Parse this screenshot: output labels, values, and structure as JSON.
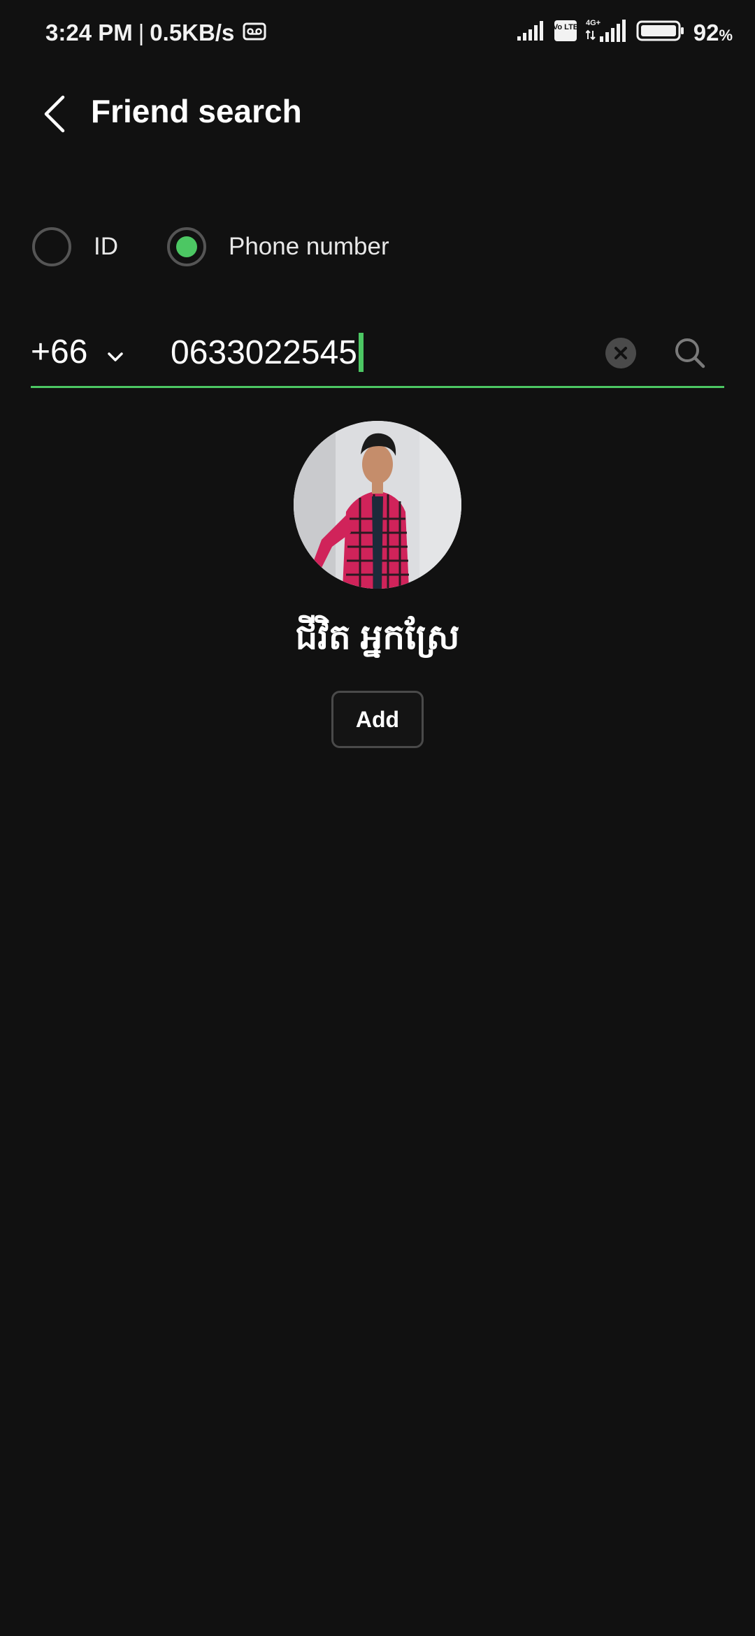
{
  "status_bar": {
    "time": "3:24 PM",
    "separator": "|",
    "speed": "0.5KB/s",
    "battery_value": "92",
    "battery_unit": "%",
    "network_label": "4G+",
    "volte_label": "Vo LTE",
    "icons": [
      "voicemail-icon",
      "signal-icon",
      "volte-icon",
      "signal-4g-icon",
      "battery-icon"
    ]
  },
  "header": {
    "back_icon": "back-arrow-icon",
    "title": "Friend search"
  },
  "search_type": {
    "options": [
      {
        "label": "ID",
        "selected": false
      },
      {
        "label": "Phone number",
        "selected": true
      }
    ]
  },
  "phone_search": {
    "country_code": "+66",
    "value": "0633022545",
    "clear_icon": "clear-icon",
    "search_icon": "search-icon"
  },
  "result": {
    "name": "ជីវិត អ្នកស្រែ",
    "add_label": "Add"
  },
  "colors": {
    "background": "#111111",
    "accent": "#4cc763",
    "text": "#ffffff"
  }
}
